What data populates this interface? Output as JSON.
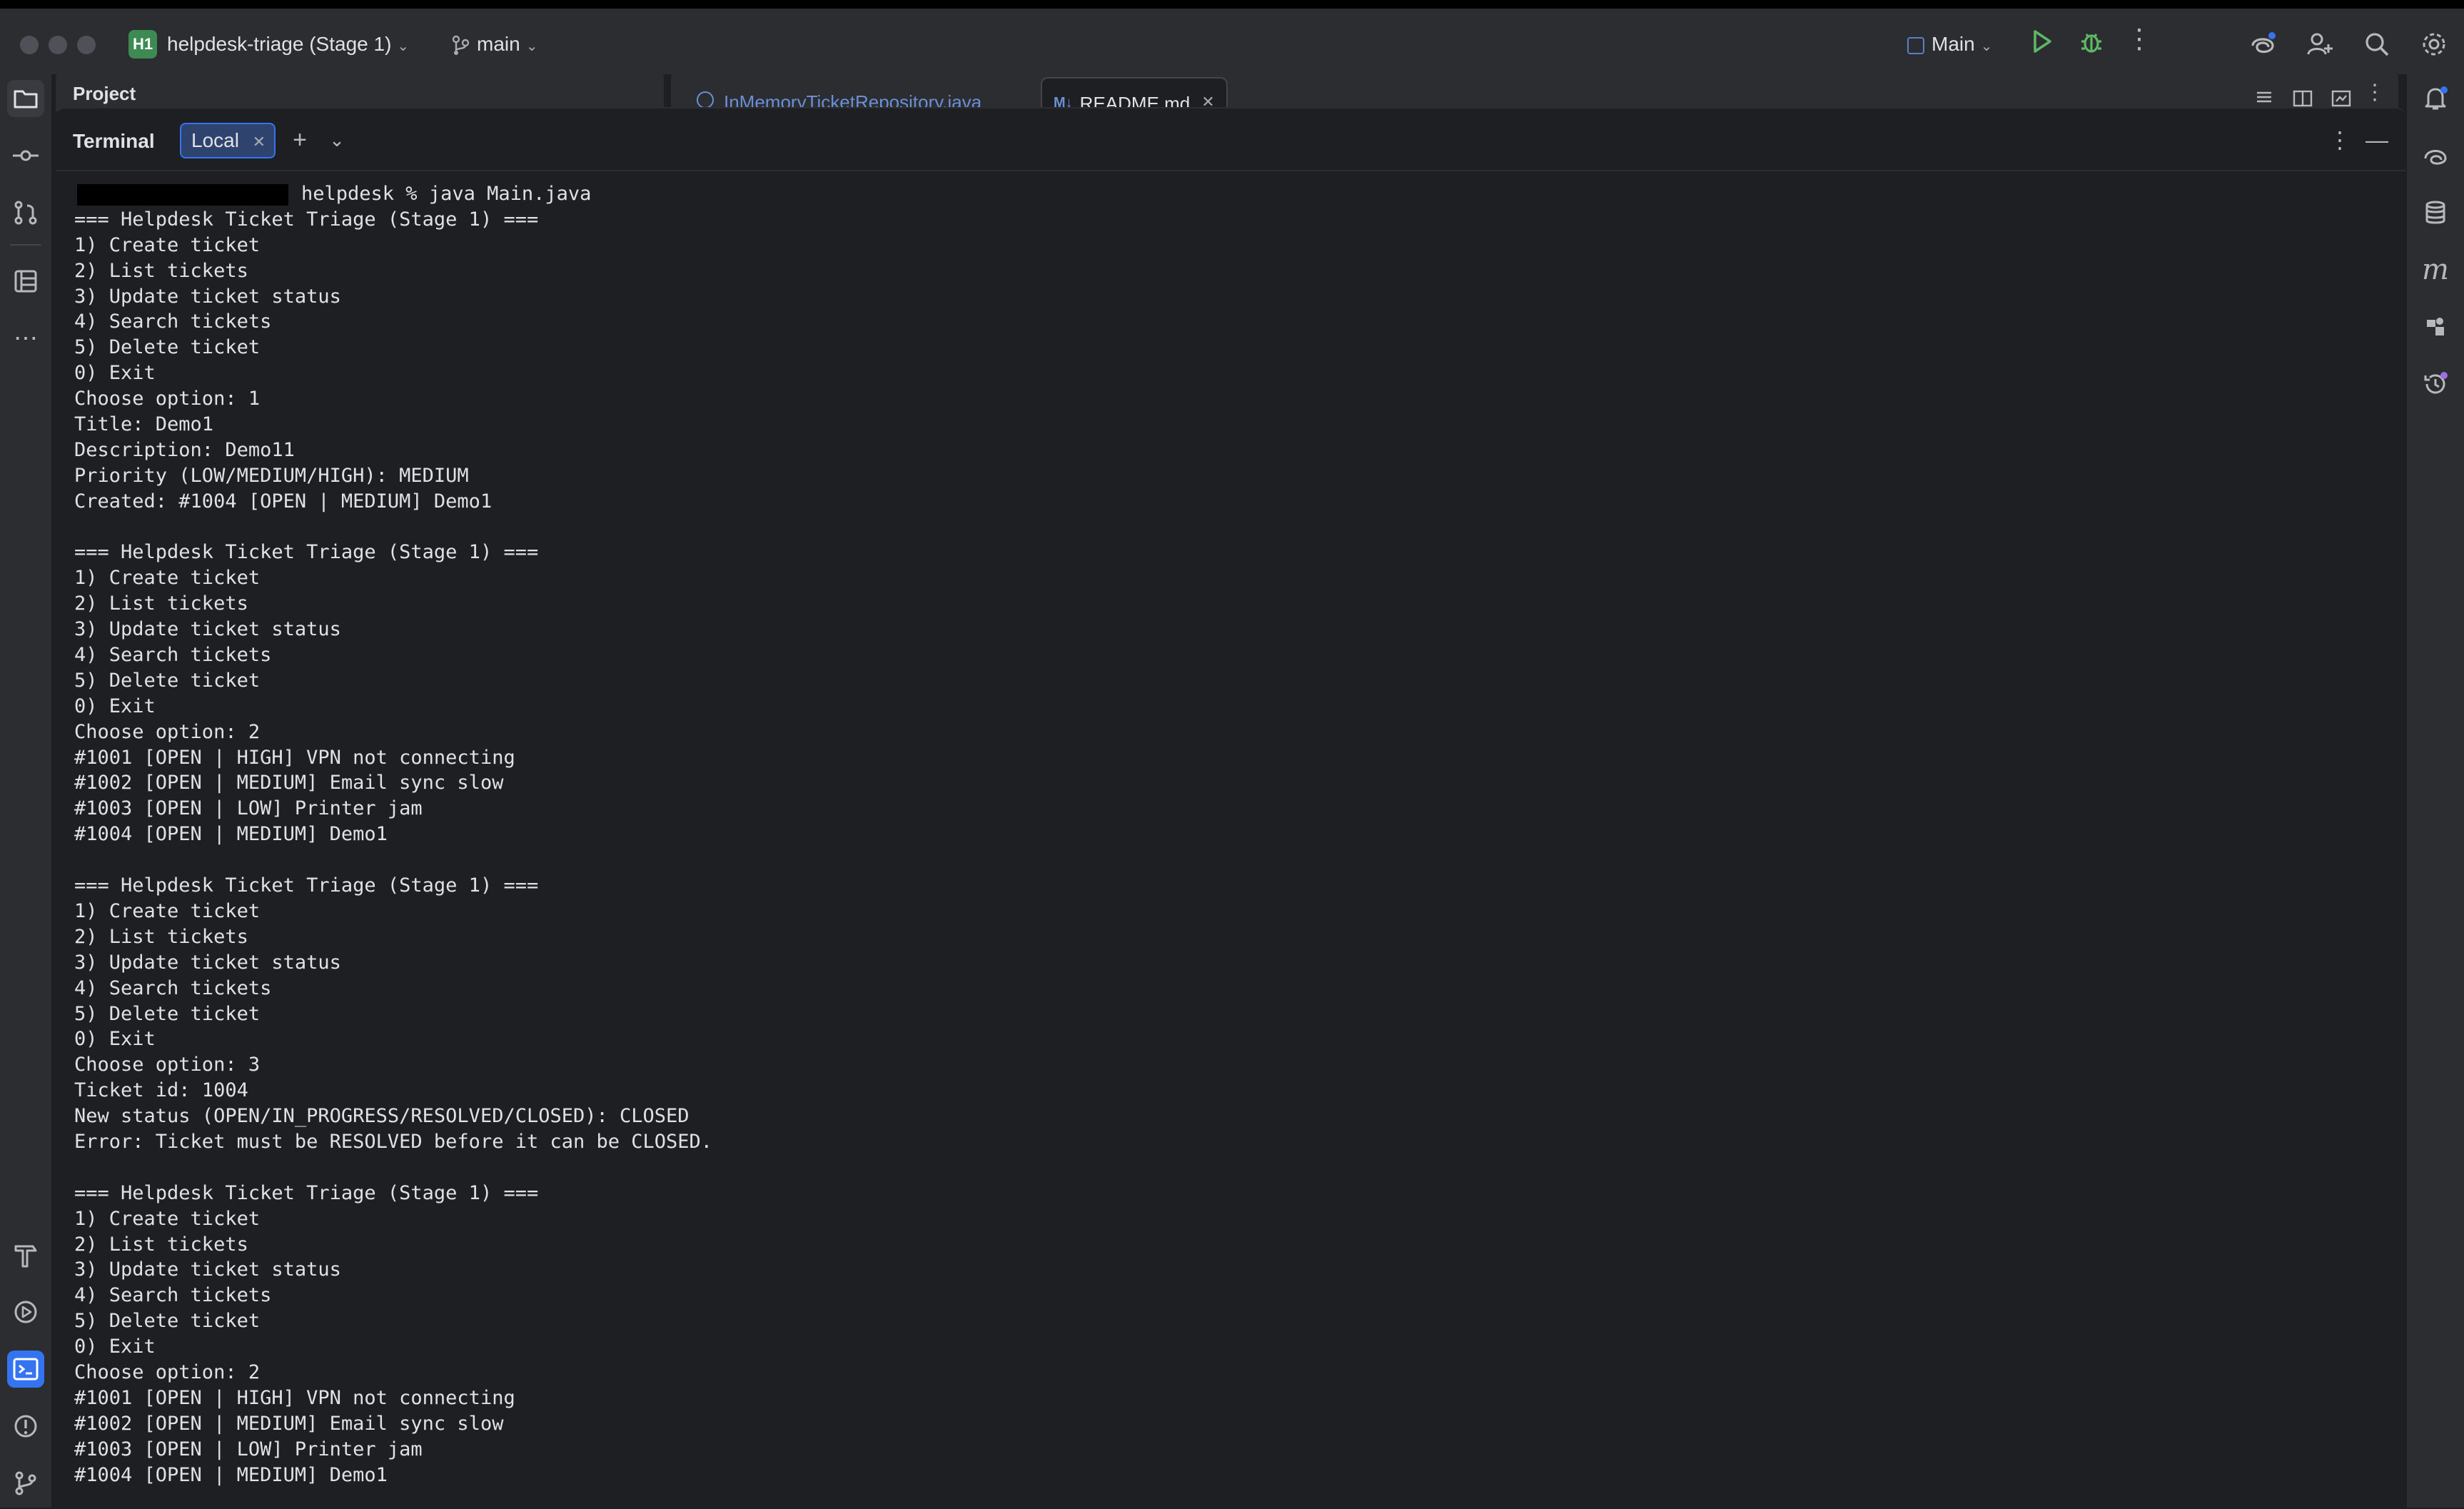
{
  "titlebar": {
    "project_badge": "H1",
    "project_name": "helpdesk-triage (Stage 1)",
    "branch": "main",
    "run_config": "Main"
  },
  "panels": {
    "project_label": "Project",
    "editor_tabs": [
      {
        "label": "InMemoryTicketRepository.java",
        "icon": "java-class-icon"
      },
      {
        "label": "README.md",
        "icon": "markdown-icon",
        "badge": "M↓"
      }
    ]
  },
  "terminal": {
    "title": "Terminal",
    "tab_label": "Local",
    "prompt_command": "helpdesk % java Main.java",
    "lines": [
      "=== Helpdesk Ticket Triage (Stage 1) ===",
      "1) Create ticket",
      "2) List tickets",
      "3) Update ticket status",
      "4) Search tickets",
      "5) Delete ticket",
      "0) Exit",
      "Choose option: 1",
      "Title: Demo1",
      "Description: Demo11",
      "Priority (LOW/MEDIUM/HIGH): MEDIUM",
      "Created: #1004 [OPEN | MEDIUM] Demo1",
      "",
      "=== Helpdesk Ticket Triage (Stage 1) ===",
      "1) Create ticket",
      "2) List tickets",
      "3) Update ticket status",
      "4) Search tickets",
      "5) Delete ticket",
      "0) Exit",
      "Choose option: 2",
      "#1001 [OPEN | HIGH] VPN not connecting",
      "#1002 [OPEN | MEDIUM] Email sync slow",
      "#1003 [OPEN | LOW] Printer jam",
      "#1004 [OPEN | MEDIUM] Demo1",
      "",
      "=== Helpdesk Ticket Triage (Stage 1) ===",
      "1) Create ticket",
      "2) List tickets",
      "3) Update ticket status",
      "4) Search tickets",
      "5) Delete ticket",
      "0) Exit",
      "Choose option: 3",
      "Ticket id: 1004",
      "New status (OPEN/IN_PROGRESS/RESOLVED/CLOSED): CLOSED",
      "Error: Ticket must be RESOLVED before it can be CLOSED.",
      "",
      "=== Helpdesk Ticket Triage (Stage 1) ===",
      "1) Create ticket",
      "2) List tickets",
      "3) Update ticket status",
      "4) Search tickets",
      "5) Delete ticket",
      "0) Exit",
      "Choose option: 2",
      "#1001 [OPEN | HIGH] VPN not connecting",
      "#1002 [OPEN | MEDIUM] Email sync slow",
      "#1003 [OPEN | LOW] Printer jam",
      "#1004 [OPEN | MEDIUM] Demo1"
    ]
  },
  "icons": {
    "left_top": [
      "folder-icon",
      "commit-icon",
      "pull-request-icon",
      "structure-icon",
      "more-icon"
    ],
    "left_bottom": [
      "build-icon",
      "services-icon",
      "terminal-icon",
      "problems-icon",
      "git-icon"
    ],
    "right": [
      "notifications-icon",
      "ai-chat-icon",
      "database-icon",
      "maven-icon",
      "plugins-icon",
      "history-icon"
    ]
  },
  "colors": {
    "accent": "#3574f0",
    "run_green": "#5fb865",
    "badge_green": "#3d8b52",
    "background": "#1e1f22",
    "chrome": "#2b2d30"
  }
}
